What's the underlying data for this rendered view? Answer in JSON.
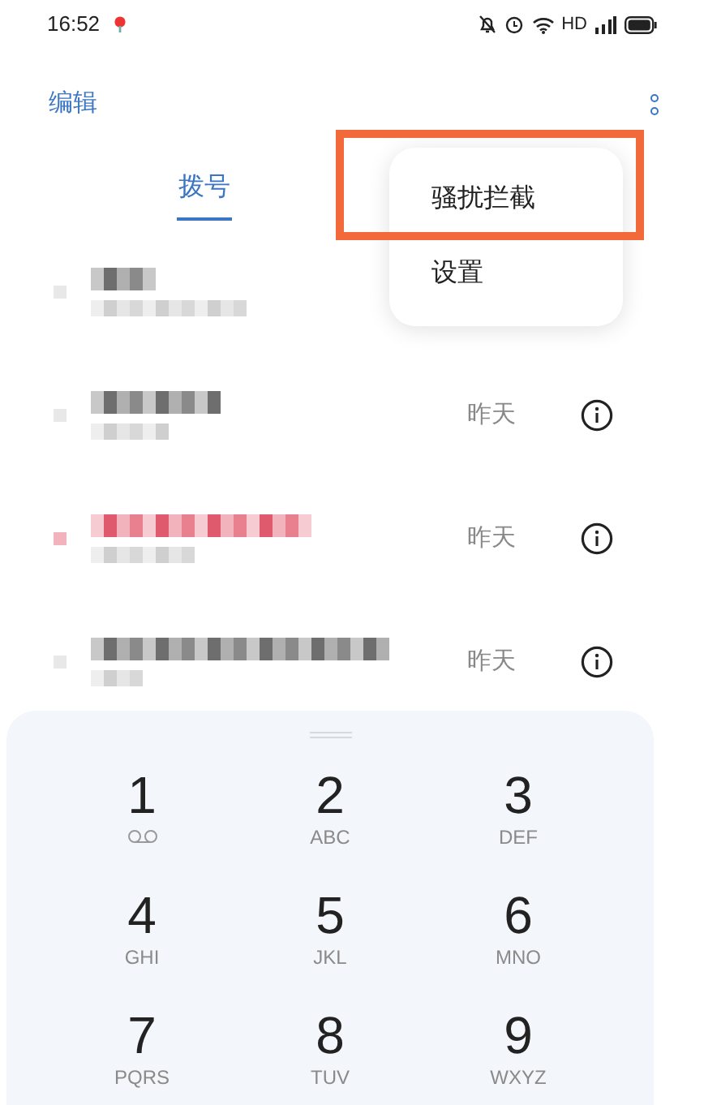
{
  "status_bar": {
    "time": "16:52",
    "network": "HD"
  },
  "header": {
    "edit": "编辑"
  },
  "tabs": [
    {
      "label": "拨号",
      "selected": true
    }
  ],
  "menu": {
    "items": [
      {
        "label": "骚扰拦截",
        "highlighted": true
      },
      {
        "label": "设置",
        "highlighted": false
      }
    ]
  },
  "calls": [
    {
      "missed": false
    },
    {
      "missed": false,
      "time": "昨天"
    },
    {
      "missed": true,
      "time": "昨天"
    },
    {
      "missed": false,
      "time": "昨天"
    }
  ],
  "keypad": [
    {
      "digit": "1",
      "kind": "voicemail"
    },
    {
      "digit": "2",
      "letters": "ABC"
    },
    {
      "digit": "3",
      "letters": "DEF"
    },
    {
      "digit": "4",
      "letters": "GHI"
    },
    {
      "digit": "5",
      "letters": "JKL"
    },
    {
      "digit": "6",
      "letters": "MNO"
    },
    {
      "digit": "7",
      "letters": "PQRS"
    },
    {
      "digit": "8",
      "letters": "TUV"
    },
    {
      "digit": "9",
      "letters": "WXYZ"
    }
  ]
}
